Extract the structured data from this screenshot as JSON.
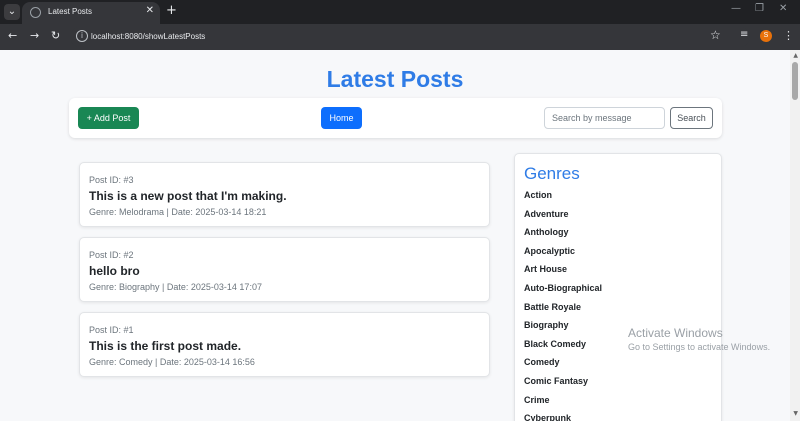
{
  "browser": {
    "tab_title": "Latest Posts",
    "url": "localhost:8080/showLatestPosts",
    "profile_initial": "S",
    "icons": [
      "tab-menu-icon",
      "globe-icon",
      "close-icon",
      "plus-icon",
      "minimize-icon",
      "restore-icon",
      "back-icon",
      "forward-icon",
      "reload-icon",
      "info-icon",
      "star-icon",
      "media-icon",
      "kebab-icon"
    ]
  },
  "page": {
    "title": "Latest Posts"
  },
  "toolbar": {
    "add_label": "+ Add Post",
    "home_label": "Home",
    "search_placeholder": "Search by message",
    "search_label": "Search"
  },
  "posts": [
    {
      "id": "Post ID: #3",
      "message": "This is a new post that I'm making.",
      "meta": "Genre: Melodrama | Date: 2025-03-14 18:21"
    },
    {
      "id": "Post ID: #2",
      "message": "hello bro",
      "meta": "Genre: Biography | Date: 2025-03-14 17:07"
    },
    {
      "id": "Post ID: #1",
      "message": "This is the first post made.",
      "meta": "Genre: Comedy | Date: 2025-03-14 16:56"
    }
  ],
  "genres": {
    "title": "Genres",
    "items": [
      "Action",
      "Adventure",
      "Anthology",
      "Apocalyptic",
      "Art House",
      "Auto-Biographical",
      "Battle Royale",
      "Biography",
      "Black Comedy",
      "Comedy",
      "Comic Fantasy",
      "Crime",
      "Cyberpunk"
    ]
  },
  "watermark": {
    "line1": "Activate Windows",
    "line2": "Go to Settings to activate Windows."
  },
  "colors": {
    "accent": "#2f7ce6",
    "add_button": "#198754",
    "home_button": "#0d6efd"
  }
}
